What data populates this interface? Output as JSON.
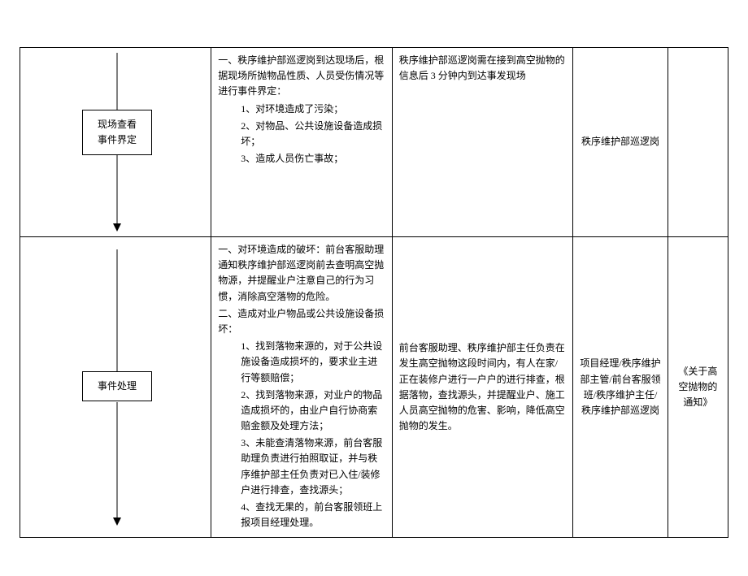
{
  "row1": {
    "flow_box_line1": "现场查看",
    "flow_box_line2": "事件界定",
    "desc_intro": "一、秩序维护部巡逻岗到达现场后，根据现场所抛物品性质、人员受伤情况等进行事件界定：",
    "desc_1": "1、对环境造成了污染；",
    "desc_2": "2、对物品、公共设施设备造成损坏；",
    "desc_3": "3、造成人员伤亡事故；",
    "req": "秩序维护部巡逻岗需在接到高空抛物的信息后 3 分钟内到达事发现场",
    "resp": "秩序维护部巡逻岗",
    "note": ""
  },
  "row2": {
    "flow_box": "事件处理",
    "desc_a": "一、对环境造成的破坏：前台客服助理通知秩序维护部巡逻岗前去查明高空抛物源，并提醒业户注意自己的行为习惯，消除高空落物的危险。",
    "desc_b": "二、造成对业户物品或公共设施设备损坏：",
    "desc_b1": "1、找到落物来源的，对于公共设施设备造成损坏的，要求业主进行等额赔偿；",
    "desc_b2": "2、找到落物来源，对业户的物品造成损坏的，由业户自行协商索赔金额及处理方法；",
    "desc_b3": "3、未能查清落物来源，前台客服助理负责进行拍照取证，并与秩序维护部主任负责对已入住/装修户进行排查，查找源头；",
    "desc_b4": "4、查找无果的，前台客服领班上报项目经理处理。",
    "req": "前台客服助理、秩序维护部主任负责在发生高空抛物这段时间内，有人在家/正在装修户进行一户户的进行排查，根据落物，查找源头，并提醒业户、施工人员高空抛物的危害、影响，降低高空抛物的发生。",
    "resp": "项目经理/秩序维护部主管/前台客服领班/秩序维护主任/秩序维护部巡逻岗",
    "note": "《关于高空抛物的通知》"
  }
}
